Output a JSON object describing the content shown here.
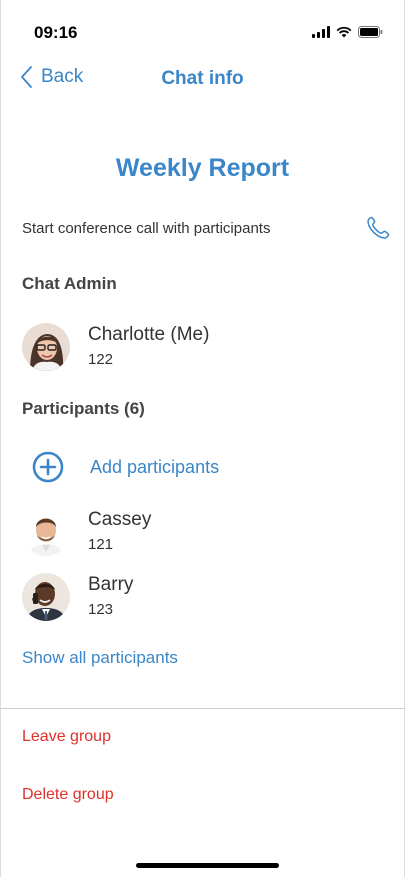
{
  "status_bar": {
    "time": "09:16"
  },
  "nav": {
    "back_label": "Back",
    "title": "Chat info"
  },
  "group": {
    "title": "Weekly Report"
  },
  "conference": {
    "label": "Start conference call with participants",
    "icon": "phone-icon"
  },
  "admin_section": {
    "heading": "Chat Admin",
    "admin": {
      "name": "Charlotte (Me)",
      "extension": "122"
    }
  },
  "participants_section": {
    "heading": "Participants (6)",
    "add_label": "Add participants",
    "items": [
      {
        "name": "Cassey",
        "extension": "121"
      },
      {
        "name": "Barry",
        "extension": "123"
      }
    ],
    "show_all_label": "Show all participants"
  },
  "actions": {
    "leave_label": "Leave group",
    "delete_label": "Delete group"
  },
  "colors": {
    "accent": "#3a86c8",
    "danger": "#e0302a",
    "text": "#333333"
  }
}
